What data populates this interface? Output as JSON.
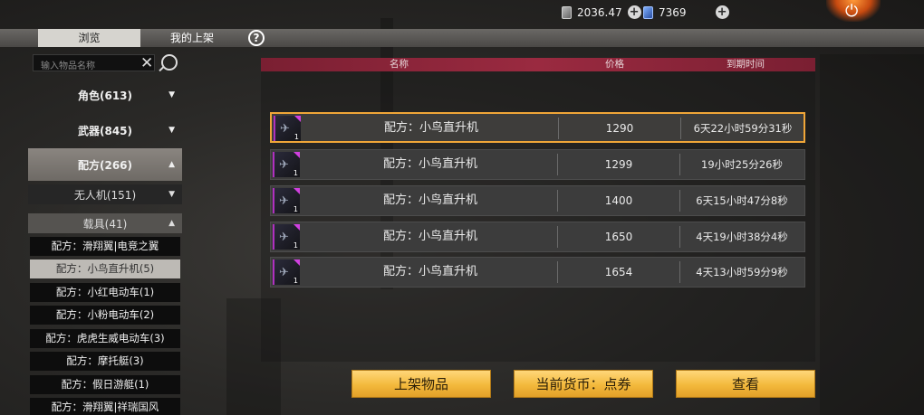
{
  "currency": {
    "coupon_amount": "2036.47",
    "diamond_amount": "7369"
  },
  "tabs": {
    "browse": "浏览",
    "my_listings": "我的上架",
    "help": "?"
  },
  "search": {
    "placeholder": "输入物品名称"
  },
  "sidebar": {
    "categories": [
      {
        "label": "角色(613)",
        "arrow": "▼"
      },
      {
        "label": "武器(845)",
        "arrow": "▼"
      },
      {
        "label": "配方(266)",
        "arrow": "▲"
      }
    ],
    "subcategories": [
      {
        "label": "无人机(151)",
        "arrow": "▼"
      },
      {
        "label": "载具(41)",
        "arrow": "▲"
      }
    ],
    "items": [
      "配方：滑翔翼|电竞之翼",
      "配方：小鸟直升机(5)",
      "配方：小红电动车(1)",
      "配方：小粉电动车(2)",
      "配方：虎虎生威电动车(3)",
      "配方：摩托艇(3)",
      "配方：假日游艇(1)",
      "配方：滑翔翼|祥瑞国风"
    ]
  },
  "table": {
    "headers": {
      "name": "名称",
      "price": "价格",
      "expire": "到期时间"
    },
    "rows": [
      {
        "name": "配方：小鸟直升机",
        "price": "1290",
        "expire": "6天22小时59分31秒",
        "count": "1"
      },
      {
        "name": "配方：小鸟直升机",
        "price": "1299",
        "expire": "19小时25分26秒",
        "count": "1"
      },
      {
        "name": "配方：小鸟直升机",
        "price": "1400",
        "expire": "6天15小时47分8秒",
        "count": "1"
      },
      {
        "name": "配方：小鸟直升机",
        "price": "1650",
        "expire": "4天19小时38分4秒",
        "count": "1"
      },
      {
        "name": "配方：小鸟直升机",
        "price": "1654",
        "expire": "4天13小时59分9秒",
        "count": "1"
      }
    ]
  },
  "buttons": {
    "list_item": "上架物品",
    "current_currency": "当前货币：点券",
    "view": "查看"
  },
  "colors": {
    "accent_gold": "#f3b93c",
    "header_red": "#9a2a40",
    "selected_border": "#f0a638",
    "rarity_purple": "#d040e0"
  }
}
